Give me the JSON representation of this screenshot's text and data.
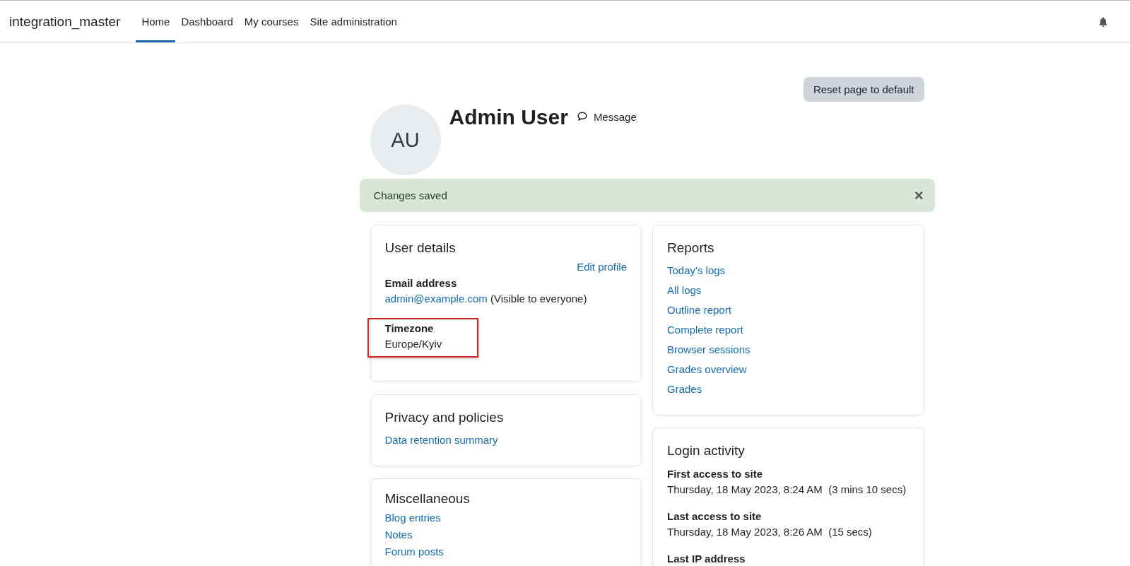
{
  "site_name": "integration_master",
  "nav": [
    {
      "label": "Home",
      "selected": true
    },
    {
      "label": "Dashboard",
      "selected": false
    },
    {
      "label": "My courses",
      "selected": false
    },
    {
      "label": "Site administration",
      "selected": false
    }
  ],
  "reset_button": "Reset page to default",
  "user": {
    "initials": "AU",
    "name": "Admin User",
    "message_link": "Message"
  },
  "alert": {
    "text": "Changes saved",
    "close": "×"
  },
  "user_details": {
    "title": "User details",
    "edit_link": "Edit profile",
    "fields": [
      {
        "label": "Email address",
        "link": "admin@example.com",
        "note": "(Visible to everyone)",
        "highlighted": false
      },
      {
        "label": "Timezone",
        "value": "Europe/Kyiv",
        "highlighted": true
      }
    ]
  },
  "privacy": {
    "title": "Privacy and policies",
    "links": [
      "Data retention summary"
    ]
  },
  "miscellaneous": {
    "title": "Miscellaneous",
    "links": [
      "Blog entries",
      "Notes",
      "Forum posts"
    ]
  },
  "reports": {
    "title": "Reports",
    "links": [
      "Today's logs",
      "All logs",
      "Outline report",
      "Complete report",
      "Browser sessions",
      "Grades overview",
      "Grades"
    ]
  },
  "login_activity": {
    "title": "Login activity",
    "fields": [
      {
        "label": "First access to site",
        "value": "Thursday, 18 May 2023, 8:24 AM  (3 mins 10 secs)"
      },
      {
        "label": "Last access to site",
        "value": "Thursday, 18 May 2023, 8:26 AM  (15 secs)"
      },
      {
        "label": "Last IP address"
      }
    ]
  }
}
